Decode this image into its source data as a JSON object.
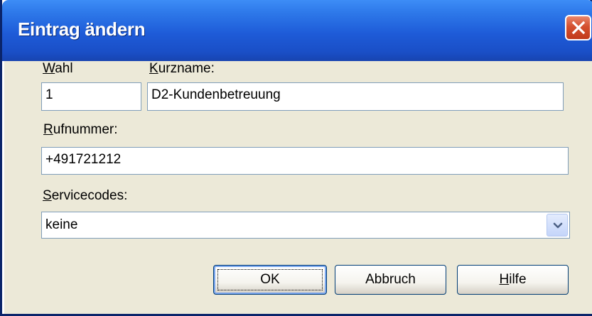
{
  "window": {
    "title": "Eintrag ändern"
  },
  "fields": {
    "wahl": {
      "label_mnemonic": "W",
      "label_rest": "ahl",
      "value": "1"
    },
    "kurzname": {
      "label_mnemonic": "K",
      "label_rest": "urzname:",
      "value": "D2-Kundenbetreuung"
    },
    "rufnummer": {
      "label_mnemonic": "R",
      "label_rest": "ufnummer:",
      "value": "+491721212"
    },
    "servicecodes": {
      "label_mnemonic": "S",
      "label_rest": "ervicecodes:",
      "selected": "keine"
    }
  },
  "buttons": {
    "ok": "OK",
    "abbruch": "Abbruch",
    "hilfe_mnemonic": "H",
    "hilfe_rest": "ilfe"
  },
  "icons": {
    "close": "close-icon",
    "dropdown": "chevron-down-icon"
  }
}
